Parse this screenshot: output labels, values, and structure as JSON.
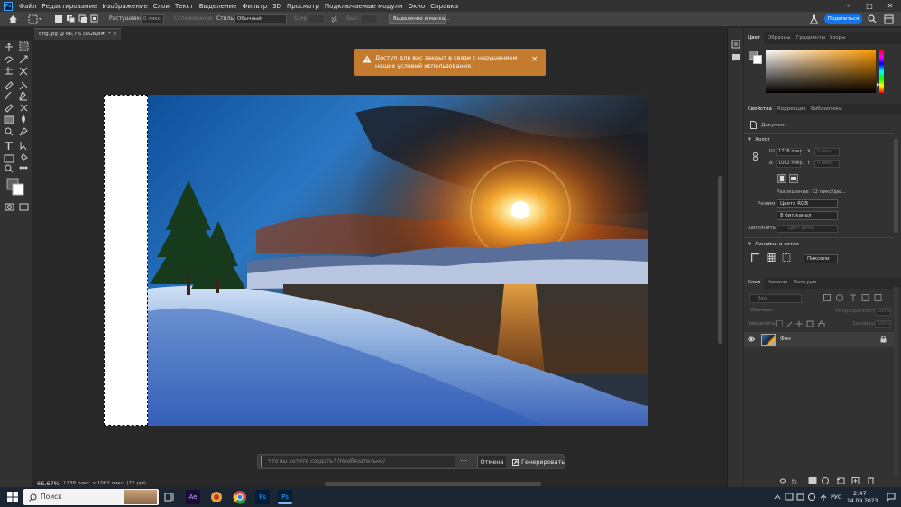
{
  "menu": {
    "items": [
      "Файл",
      "Редактирование",
      "Изображение",
      "Слои",
      "Текст",
      "Выделение",
      "Фильтр",
      "3D",
      "Просмотр",
      "Подключаемые модули",
      "Окно",
      "Справка"
    ],
    "app_logo": "Ps"
  },
  "options": {
    "feather_label": "Растушевка:",
    "feather_value": "0 пикс.",
    "antialias_label": "Сглаживание",
    "style_label": "Стиль:",
    "style_value": "Обычный",
    "width_label": "Шир.:",
    "height_label": "Выс.:",
    "select_mask_label": "Выделение и маска...",
    "share_label": "Поделиться"
  },
  "document": {
    "tab_title": "orig.jpg @ 66,7% (RGB/8#) *",
    "zoom": "66,67%",
    "info": "1738 пикс. x 1062 пикс. (72 ppi)"
  },
  "toast": {
    "message": "Доступ для вас закрыт в связи с нарушением наших условий использования.",
    "icon": "warning-icon"
  },
  "generate_bar": {
    "placeholder": "Что вы хотите создать? (Необязательно)",
    "cancel_label": "Отмена",
    "generate_label": "Генерировать"
  },
  "color_panel": {
    "tabs": [
      "Цвет",
      "Образцы",
      "Градиенты",
      "Узоры"
    ],
    "hue_color": "#ff9900"
  },
  "properties_panel": {
    "tabs": [
      "Свойства",
      "Коррекция",
      "Библиотеки"
    ],
    "doc_label": "Документ",
    "canvas_section": "Холст",
    "w_label": "Ш",
    "w_value": "1738 пикс.",
    "h_label": "В",
    "h_value": "1062 пикс.",
    "x_label": "X",
    "x_value": "0 пикс.",
    "y_label": "Y",
    "y_value": "0 пикс.",
    "resolution": "Разрешение: 72 пикс/дю...",
    "mode_label": "Режим",
    "mode_value": "Цвета RGB",
    "depth_value": "8 бит/канал",
    "fill_label": "Заполнить",
    "fill_value": "Цвет фона",
    "rulers_section": "Линейки и сетки",
    "units_value": "Пиксели"
  },
  "layers_panel": {
    "tabs": [
      "Слои",
      "Каналы",
      "Контуры"
    ],
    "search_placeholder": "Вид",
    "blend_mode": "Обычные",
    "opacity_label": "Непрозрачность:",
    "opacity_value": "100%",
    "lock_label": "Закрепить:",
    "fill_label": "Заливка:",
    "fill_value": "100%",
    "layers": [
      {
        "name": "Фон",
        "locked": true
      }
    ]
  },
  "taskbar": {
    "search_label": "Поиск",
    "lang": "РУС",
    "time": "2:47",
    "date": "14.09.2023",
    "accent": "#1c2633"
  }
}
